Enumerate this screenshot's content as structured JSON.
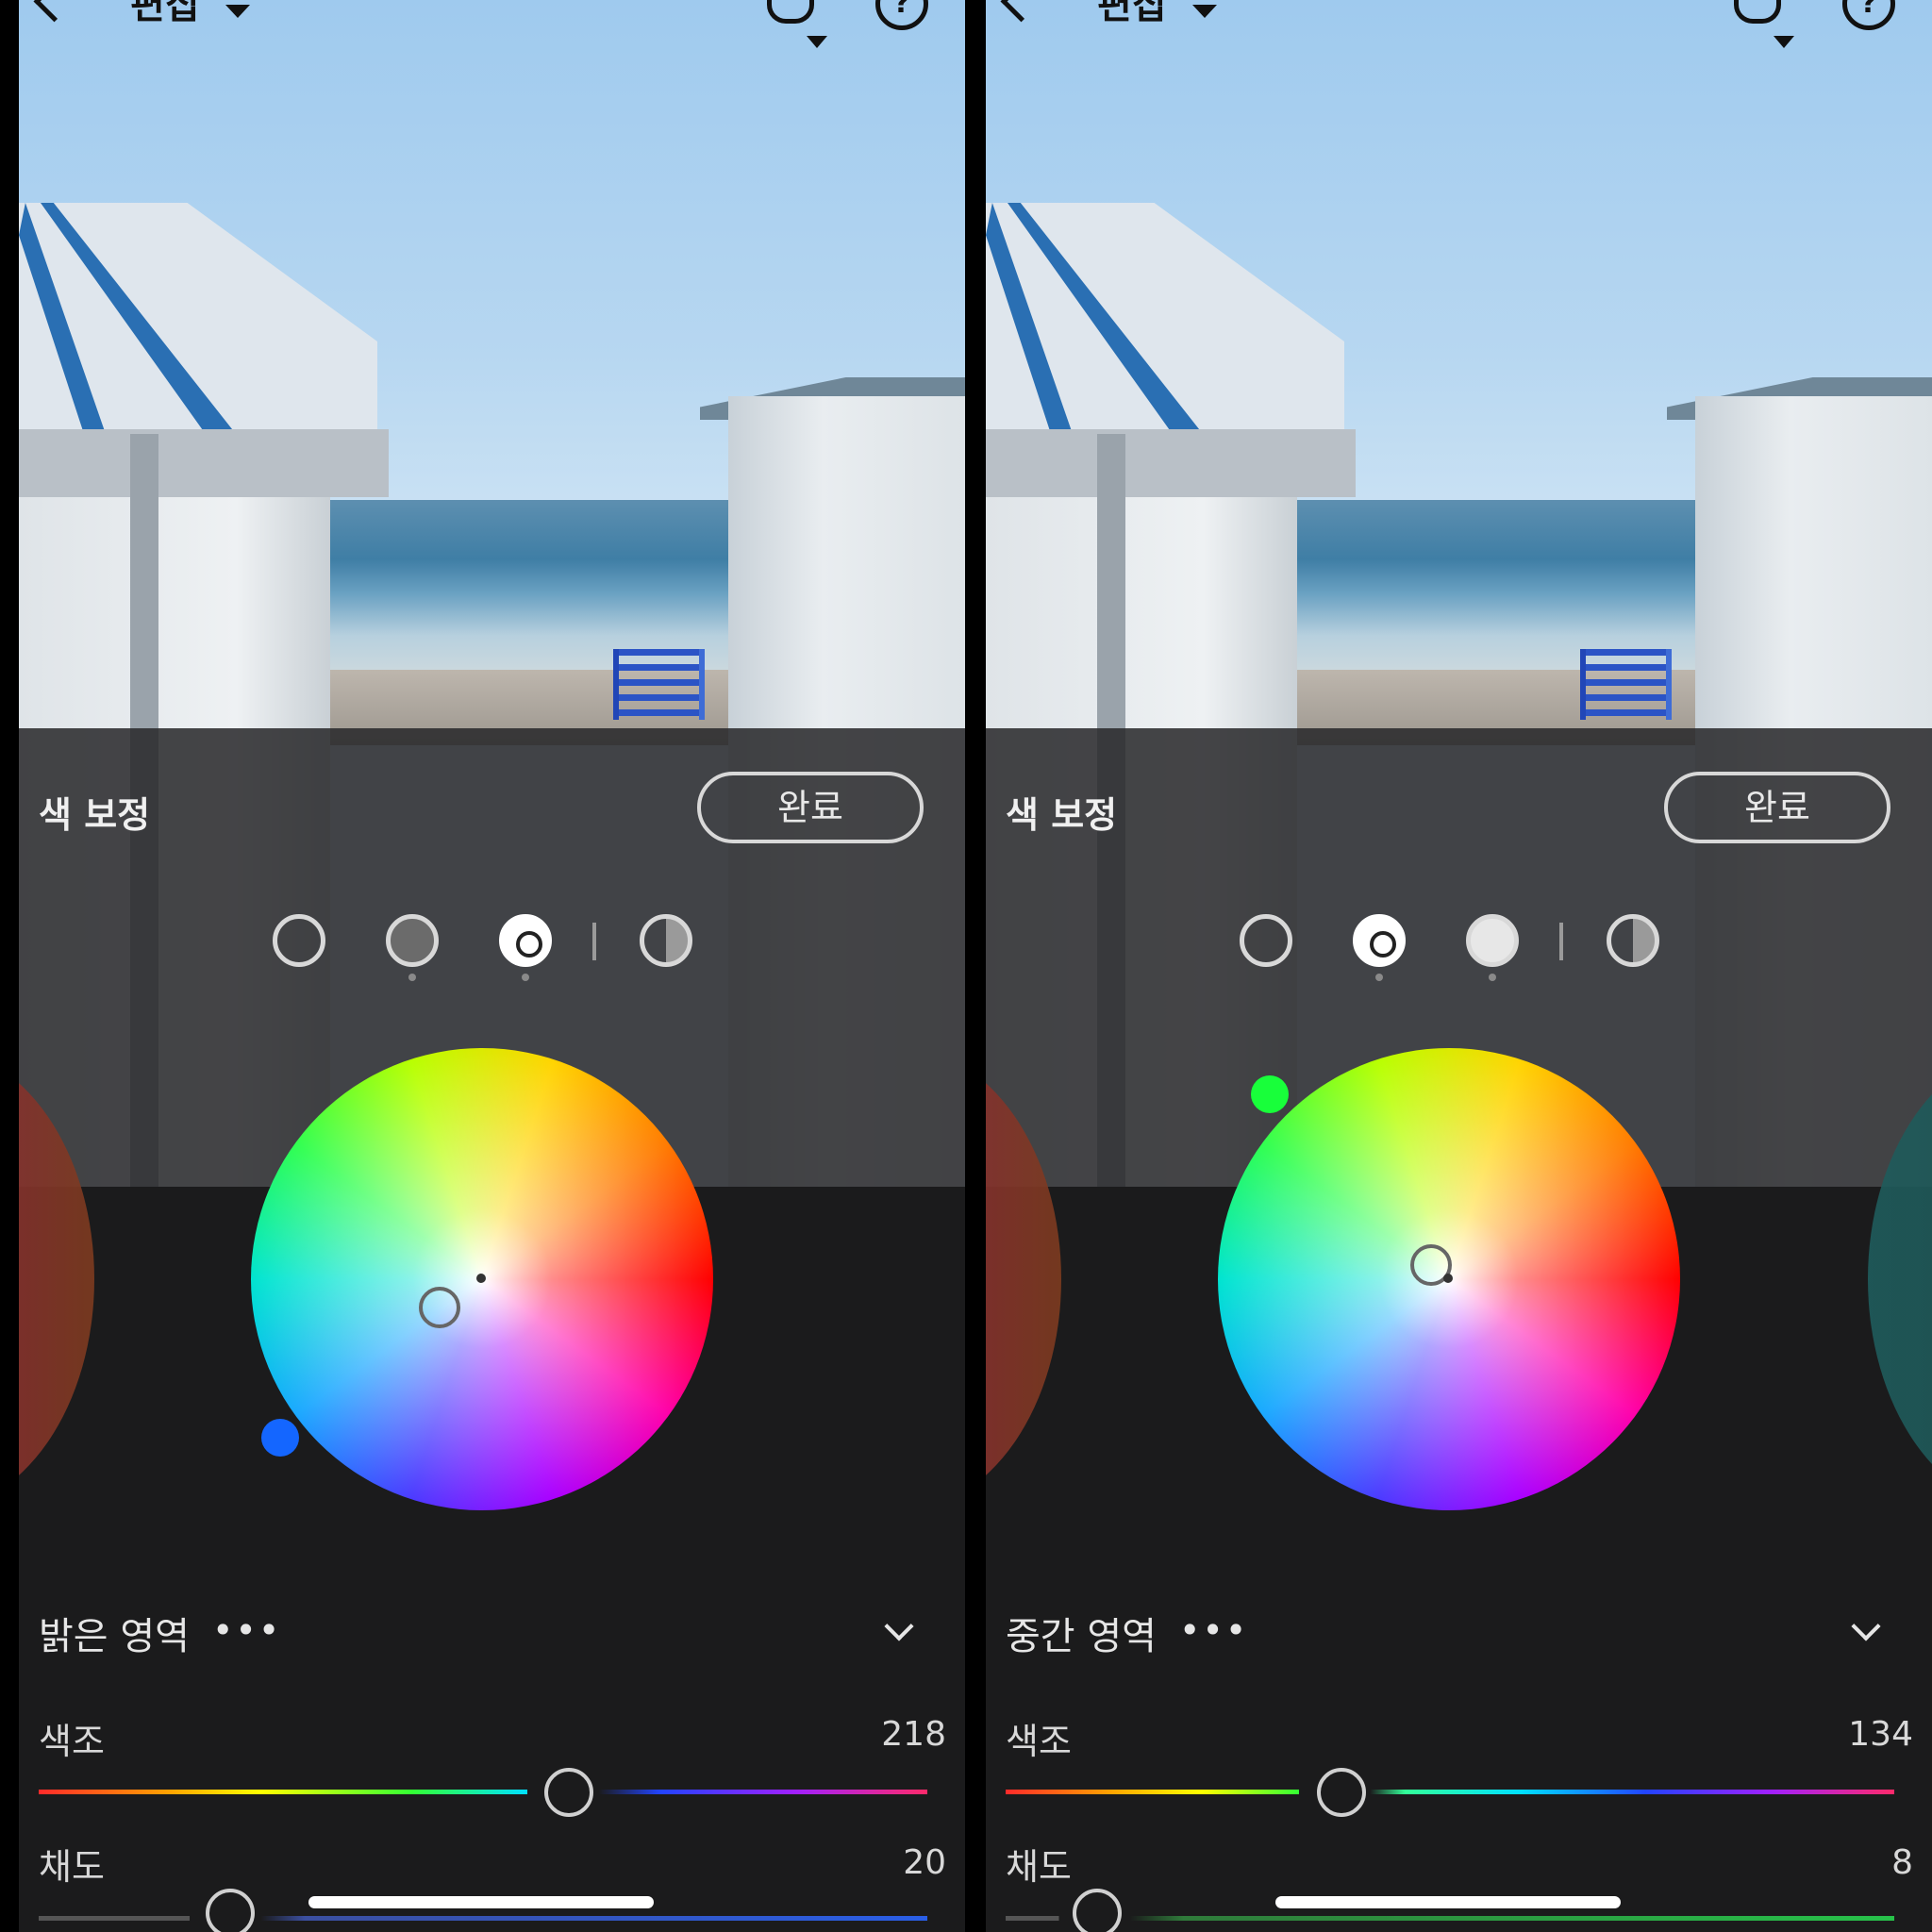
{
  "colors": {
    "panel_bg": "#1b1b1c",
    "left_knob_color": "#1466ff",
    "right_knob_color": "#18ff3a"
  },
  "header": {
    "mode_label": "편집",
    "icons": [
      "back-icon",
      "chevron-down-icon",
      "undo-icon",
      "help-icon"
    ]
  },
  "left_pane": {
    "panel_title": "색 보정",
    "done_label": "완료",
    "selected_mode": "highlights",
    "region_label": "밝은 영역",
    "hue": {
      "label": "색조",
      "value": "218"
    },
    "saturation": {
      "label": "채도",
      "value": "20"
    }
  },
  "right_pane": {
    "panel_title": "색 보정",
    "done_label": "완료",
    "selected_mode": "midtones",
    "region_label": "중간 영역",
    "hue": {
      "label": "색조",
      "value": "134"
    },
    "saturation": {
      "label": "채도",
      "value": "8"
    }
  }
}
